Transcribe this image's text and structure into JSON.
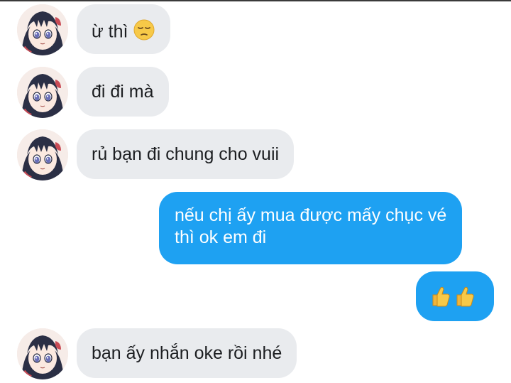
{
  "messages": [
    {
      "direction": "incoming",
      "text": "ừ thì",
      "emoji": "pensive-face"
    },
    {
      "direction": "incoming",
      "text": "đi đi mà"
    },
    {
      "direction": "incoming",
      "text": "rủ bạn đi chung cho vuii"
    },
    {
      "direction": "outgoing",
      "lines": [
        "nếu chị ấy mua được mấy chục vé",
        "thì ok em đi"
      ]
    },
    {
      "direction": "outgoing",
      "emoji": "thumbs-up-thumbs-up"
    },
    {
      "direction": "incoming",
      "text": "bạn ấy nhắn oke rồi nhé"
    }
  ],
  "avatar": {
    "icon": "anime-girl-avatar-icon"
  },
  "colors": {
    "incoming_bubble": "#e9ebee",
    "outgoing_bubble": "#1ea1f2",
    "incoming_text": "#1c1e21",
    "outgoing_text": "#ffffff"
  }
}
